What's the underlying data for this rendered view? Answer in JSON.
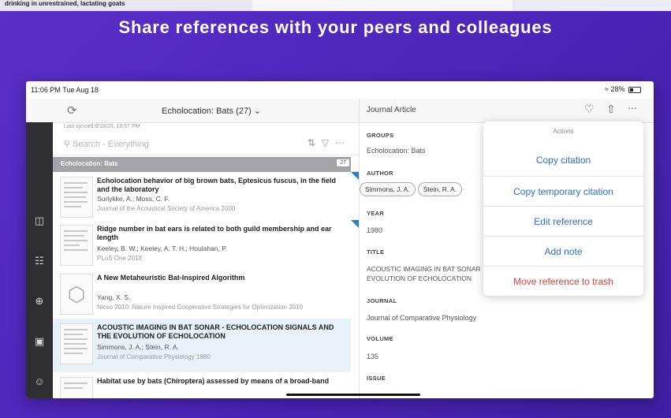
{
  "background_snippet": "drinking in unrestrained, lactating goats",
  "headline": "Share references with your peers and colleagues",
  "status": {
    "time": "11:06 PM  Tue Aug 18",
    "battery": "28%"
  },
  "list": {
    "collection_title": "Echolocation: Bats (27)",
    "last_synced": "Last synced 8/18/20, 10:57 PM",
    "search_placeholder": "Search - Everything",
    "collection_bar_label": "Echolocation: Bats",
    "collection_count": "27",
    "items": [
      {
        "title": "Echolocation behavior of big brown bats, Eptesicus fuscus, in the field and the laboratory",
        "authors": "Surlykke, A.; Moss, C. F.",
        "source": "Journal of the Acoustical Society of America 2000"
      },
      {
        "title": "Ridge number in bat ears is related to both guild membership and ear length",
        "authors": "Keeley, B. W.; Keeley, A. T. H.; Houlahan, P.",
        "source": "PLoS One 2018"
      },
      {
        "title": "A New Metaheuristic Bat-Inspired Algorithm",
        "authors": "Yang, X. S.",
        "source": "Nicso 2010: Nature Inspired Cooperative Strategies for Optimization 2010"
      },
      {
        "title": "ACOUSTIC IMAGING IN BAT SONAR - ECHOLOCATION SIGNALS AND THE EVOLUTION OF ECHOLOCATION",
        "authors": "Simmons, J. A.; Stein, R. A.",
        "source": "Journal of Comparative Physiology 1980"
      },
      {
        "title": "Habitat use by bats (Chiroptera) assessed by means of a broad-band",
        "authors": "",
        "source": ""
      }
    ]
  },
  "detail": {
    "type": "Journal Article",
    "groups_label": "GROUPS",
    "groups_value": "Echolocation: Bats",
    "author_label": "AUTHOR",
    "authors": [
      "Simmons, J. A.",
      "Stein, R. A."
    ],
    "year_label": "YEAR",
    "year": "1980",
    "title_label": "TITLE",
    "title": "ACOUSTIC IMAGING IN BAT SONAR\nEVOLUTION OF ECHOLOCATION",
    "journal_label": "JOURNAL",
    "journal": "Journal of Comparative Physiology",
    "volume_label": "VOLUME",
    "volume": "135",
    "issue_label": "ISSUE"
  },
  "popover": {
    "title": "Actions",
    "copy_citation": "Copy citation",
    "copy_temp": "Copy temporary citation",
    "edit": "Edit reference",
    "add_note": "Add note",
    "trash": "Move reference to trash"
  },
  "colors": {
    "accent": "#2f6fcf",
    "danger": "#e0403b",
    "background": "#4b24b8"
  },
  "icons": [
    "refresh-icon",
    "chevron-down-icon",
    "search-icon",
    "sort-icon",
    "filter-icon",
    "more-icon",
    "heart-icon",
    "share-icon",
    "library-icon",
    "globe-icon",
    "add-icon",
    "download-icon",
    "profile-icon",
    "wifi-icon",
    "battery-icon"
  ]
}
